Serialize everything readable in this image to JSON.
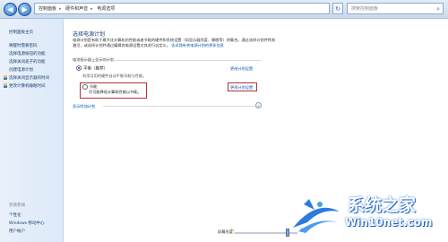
{
  "toolbar": {
    "address_segments": [
      "控制面板",
      "硬件和声音",
      "电源选项"
    ],
    "search_placeholder": "搜索控制面板"
  },
  "sidebar": {
    "items": [
      {
        "label": "控制面板主页"
      },
      {
        "label": "唤醒时需要密码"
      },
      {
        "label": "选择电源按钮的功能"
      },
      {
        "label": "选择关闭盖子的功能"
      },
      {
        "label": "创建电源计划"
      },
      {
        "label": "选择关闭显示器的时间"
      },
      {
        "label": "更改计算机睡眠时间"
      }
    ],
    "see_also_title": "另请参阅",
    "see_also": [
      {
        "label": "个性化"
      },
      {
        "label": "Windows 移动中心"
      },
      {
        "label": "用户帐户"
      }
    ]
  },
  "main": {
    "title": "选择电源计划",
    "description": "电源计划是有助于最大化计算机的性能或者节能的硬件和系统设置（如显示器亮度、睡眠等）的集合。通过选择计划并将其激活，或选择计划并通过编辑其电源设置对其进行自定义。",
    "description_link": "告诉我有关电源计划的更多信息",
    "section_label": "电池指示器上显示的计划",
    "plans": [
      {
        "name": "平衡（推荐）",
        "detail": "利用可用的硬件自动平衡功耗与性能。",
        "link": "更改计划设置",
        "selected": true
      },
      {
        "name": "节能",
        "detail": "尽可能降低计算机性能以节能。",
        "link": "更改计划设置",
        "selected": false
      }
    ],
    "show_more": "显示附加计划",
    "brightness_label": "屏幕亮度："
  },
  "watermark": {
    "cn": "系统之家",
    "en": "Win10net.com"
  },
  "colors": {
    "accent": "#2a6ad0",
    "highlight_box": "#b0313a",
    "link": "#0a55b0"
  }
}
